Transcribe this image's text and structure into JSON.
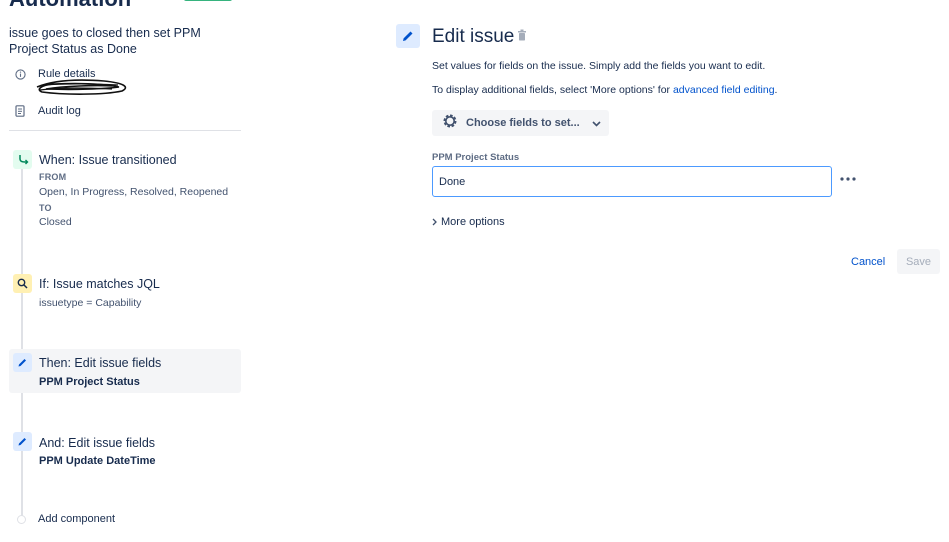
{
  "header": {
    "title": "Automation"
  },
  "rule": {
    "name": "issue goes to closed then set PPM Project Status as Done",
    "details_label": "Rule details",
    "audit_label": "Audit log"
  },
  "steps": [
    {
      "title": "When: Issue transitioned",
      "from_label": "FROM",
      "from_value": "Open, In Progress, Resolved, Reopened",
      "to_label": "TO",
      "to_value": "Closed"
    },
    {
      "title": "If: Issue matches JQL",
      "sub": "issuetype = Capability"
    },
    {
      "title": "Then: Edit issue fields",
      "sub": "PPM Project Status"
    },
    {
      "title": "And: Edit issue fields",
      "sub": "PPM Update DateTime"
    }
  ],
  "add_component_label": "Add component",
  "editor": {
    "title": "Edit issue",
    "desc1": "Set values for fields on the issue. Simply add the fields you want to edit.",
    "desc2_prefix": "To display additional fields, select 'More options' for ",
    "desc2_link": "advanced field editing",
    "desc2_suffix": ".",
    "choose_label": "Choose fields to set...",
    "field_label": "PPM Project Status",
    "field_value": "Done",
    "more_options_label": "More options",
    "cancel_label": "Cancel",
    "save_label": "Save"
  },
  "colors": {
    "accent": "#0052cc",
    "selected_bg": "#f4f5f7",
    "trigger_bg": "#e3fcef",
    "condition_bg": "#fff0b3",
    "action_bg": "#deebff"
  }
}
